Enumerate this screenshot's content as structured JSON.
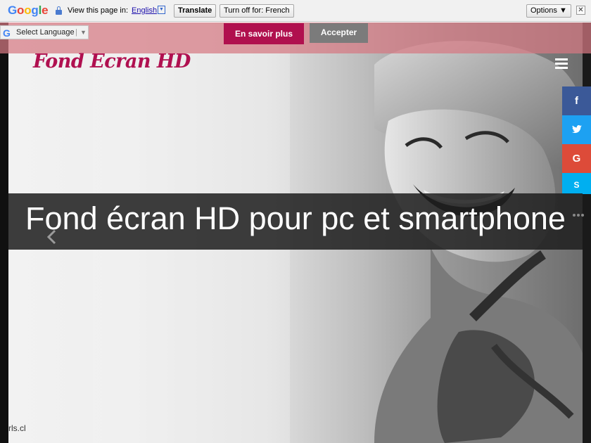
{
  "translate_bar": {
    "logo_letters": [
      "G",
      "o",
      "o",
      "g",
      "l",
      "e"
    ],
    "prompt": "View this page in:",
    "language": "English",
    "language_arrow": "▼",
    "translate_label": "Translate",
    "turn_off_label": "Turn off for: French",
    "options_label": "Options ▼",
    "close_label": "✕"
  },
  "language_selector": {
    "icon_letter": "G",
    "label": "Select Language",
    "separator": "|",
    "arrow": "▼"
  },
  "cookie_banner": {
    "learn_more": "En savoir plus",
    "accept": "Accepter"
  },
  "header": {
    "logo_text": "Fond Ecran HD"
  },
  "social": {
    "facebook": "f",
    "twitter": "🐦",
    "google_plus": "G",
    "skype": "S"
  },
  "hero": {
    "title": "Fond écran HD pour pc et smartphone",
    "watermark": "rls.cl"
  },
  "colors": {
    "brand": "#b01050",
    "banner_overlay": "rgba(214,120,130,0.72)",
    "facebook": "#3b5998",
    "twitter": "#1da1f2",
    "google_plus": "#dd4b39",
    "skype": "#00aff0"
  }
}
